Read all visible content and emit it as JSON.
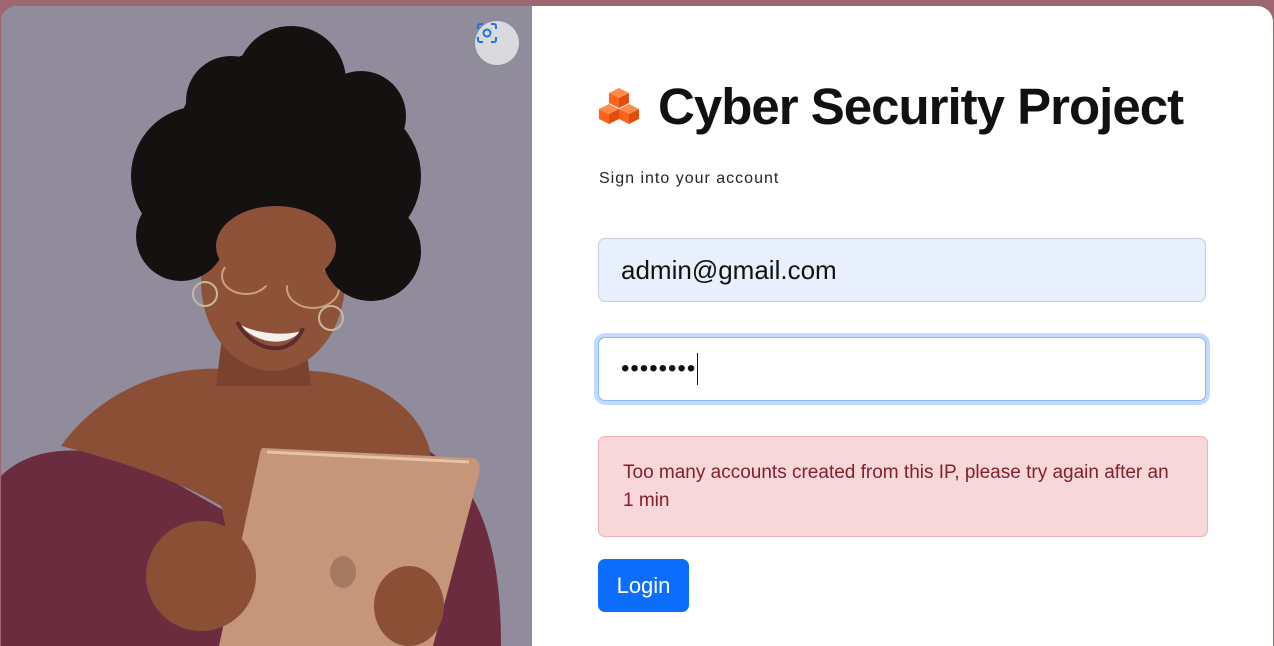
{
  "header": {
    "title": "Cyber Security Project",
    "logo_icon": "cubes-icon",
    "brand_color": "#ff6219"
  },
  "form": {
    "subtitle": "Sign into your account",
    "email_value": "admin@gmail.com",
    "password_masked": "••••••••",
    "error_message": "Too many accounts created from this IP, please try again after an 1 min",
    "login_label": "Login"
  },
  "photo": {
    "lens_button_icon": "visual-search-icon"
  },
  "colors": {
    "primary": "#0d6efd",
    "alert_bg": "#f8d7da",
    "alert_text": "#842029",
    "autofill_bg": "#e8f0fe"
  }
}
